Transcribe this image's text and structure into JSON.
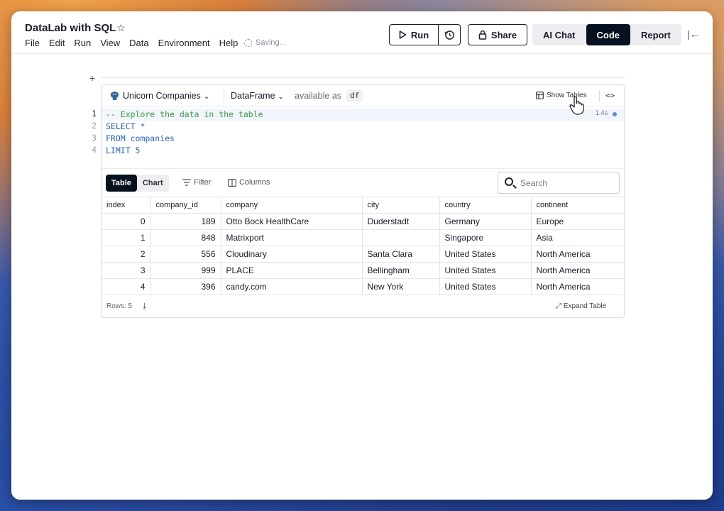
{
  "app": {
    "title": "DataLab with SQL",
    "status": "Saving..."
  },
  "menu": [
    "File",
    "Edit",
    "Run",
    "View",
    "Data",
    "Environment",
    "Help"
  ],
  "toolbar": {
    "run_label": "Run",
    "share_label": "Share",
    "modes": [
      "AI Chat",
      "Code",
      "Report"
    ],
    "active_mode": "Code"
  },
  "cell": {
    "source": "Unicorn Companies",
    "output_type": "DataFrame",
    "available_as": "available as",
    "variable": "df",
    "show_tables": "Show Tables",
    "runtime": "1.4s",
    "code": [
      "-- Explore the data in the table",
      "SELECT *",
      "FROM companies",
      "LIMIT 5"
    ]
  },
  "results": {
    "tabs": [
      "Table",
      "Chart"
    ],
    "active_tab": "Table",
    "filter_label": "Filter",
    "columns_label": "Columns",
    "search_placeholder": "Search",
    "headers": [
      "index",
      "company_id",
      "company",
      "city",
      "country",
      "continent"
    ],
    "rows": [
      [
        "0",
        "189",
        "Otto Bock HealthCare",
        "Duderstadt",
        "Germany",
        "Europe"
      ],
      [
        "1",
        "848",
        "Matrixport",
        "",
        "Singapore",
        "Asia"
      ],
      [
        "2",
        "556",
        "Cloudinary",
        "Santa Clara",
        "United States",
        "North America"
      ],
      [
        "3",
        "999",
        "PLACE",
        "Bellingham",
        "United States",
        "North America"
      ],
      [
        "4",
        "396",
        "candy.com",
        "New York",
        "United States",
        "North America"
      ]
    ],
    "rows_label": "Rows: 5",
    "expand_label": "Expand Table"
  },
  "colors": {
    "accent_dark": "#06111f",
    "keyword": "#2b63b9",
    "comment": "#3f9a4a"
  }
}
